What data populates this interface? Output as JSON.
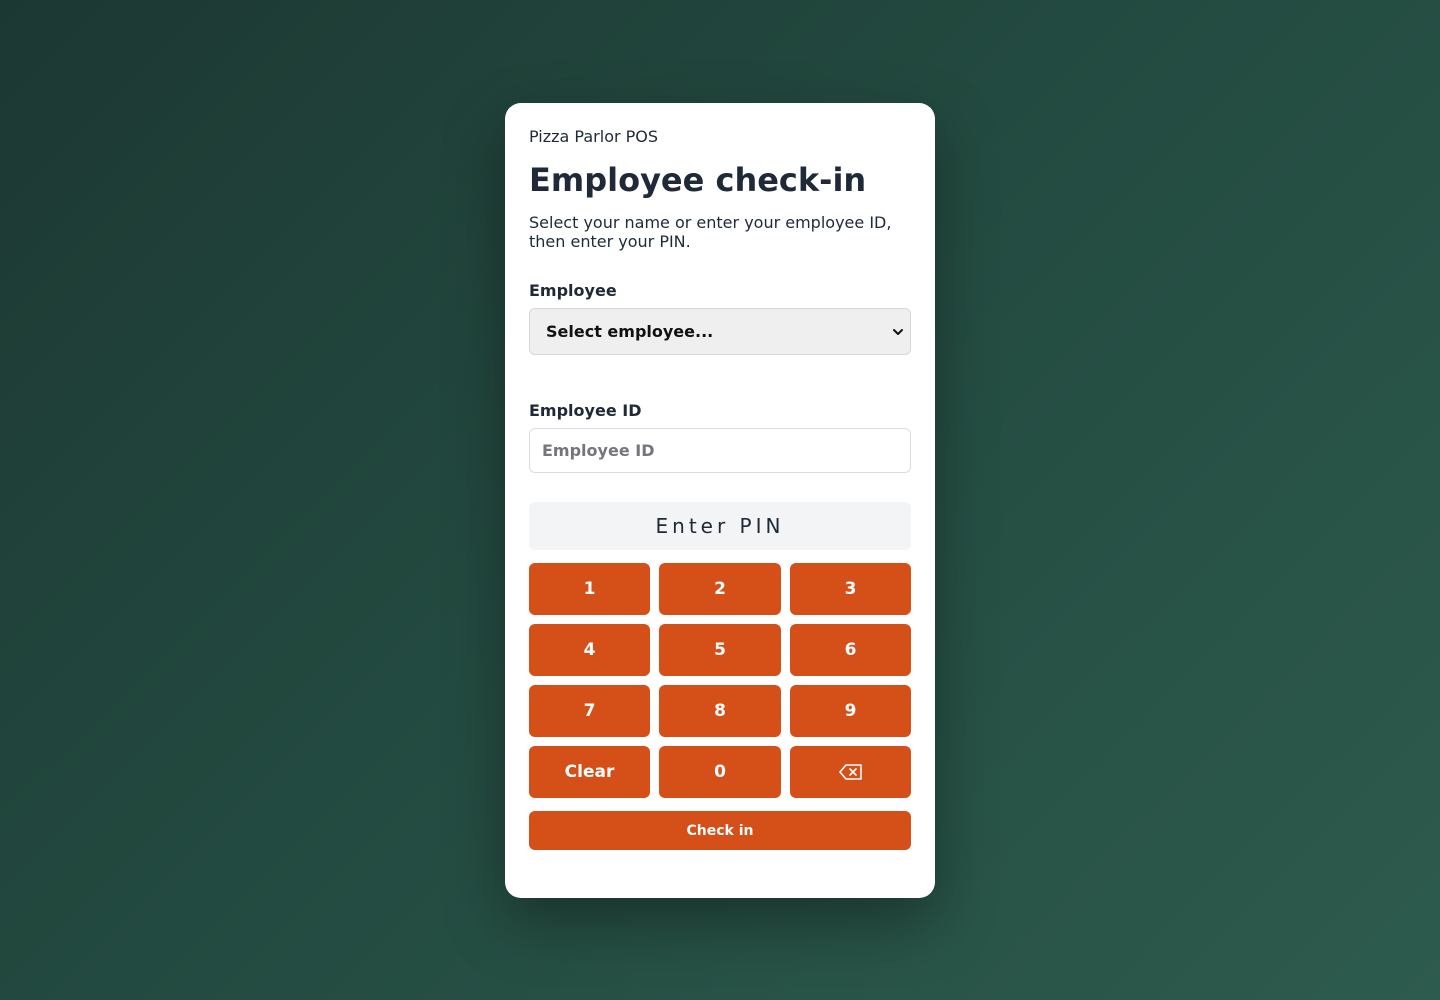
{
  "brand": "Pizza Parlor POS",
  "title": "Employee check-in",
  "subtitle": "Select your name or enter your employee ID, then enter your PIN.",
  "employee": {
    "label": "Employee",
    "selected": "Select employee...",
    "icon": "chevron-down-icon"
  },
  "employee_id": {
    "label": "Employee ID",
    "placeholder": "Employee ID"
  },
  "pin_display": "Enter PIN",
  "keypad": {
    "k1": "1",
    "k2": "2",
    "k3": "3",
    "k4": "4",
    "k5": "5",
    "k6": "6",
    "k7": "7",
    "k8": "8",
    "k9": "9",
    "clear": "Clear",
    "k0": "0",
    "backspace_icon": "backspace-icon"
  },
  "checkin_label": "Check in",
  "colors": {
    "accent": "#d55019",
    "background_dark": "#1c3832",
    "background_light": "#2d5b4d",
    "card": "#ffffff"
  }
}
